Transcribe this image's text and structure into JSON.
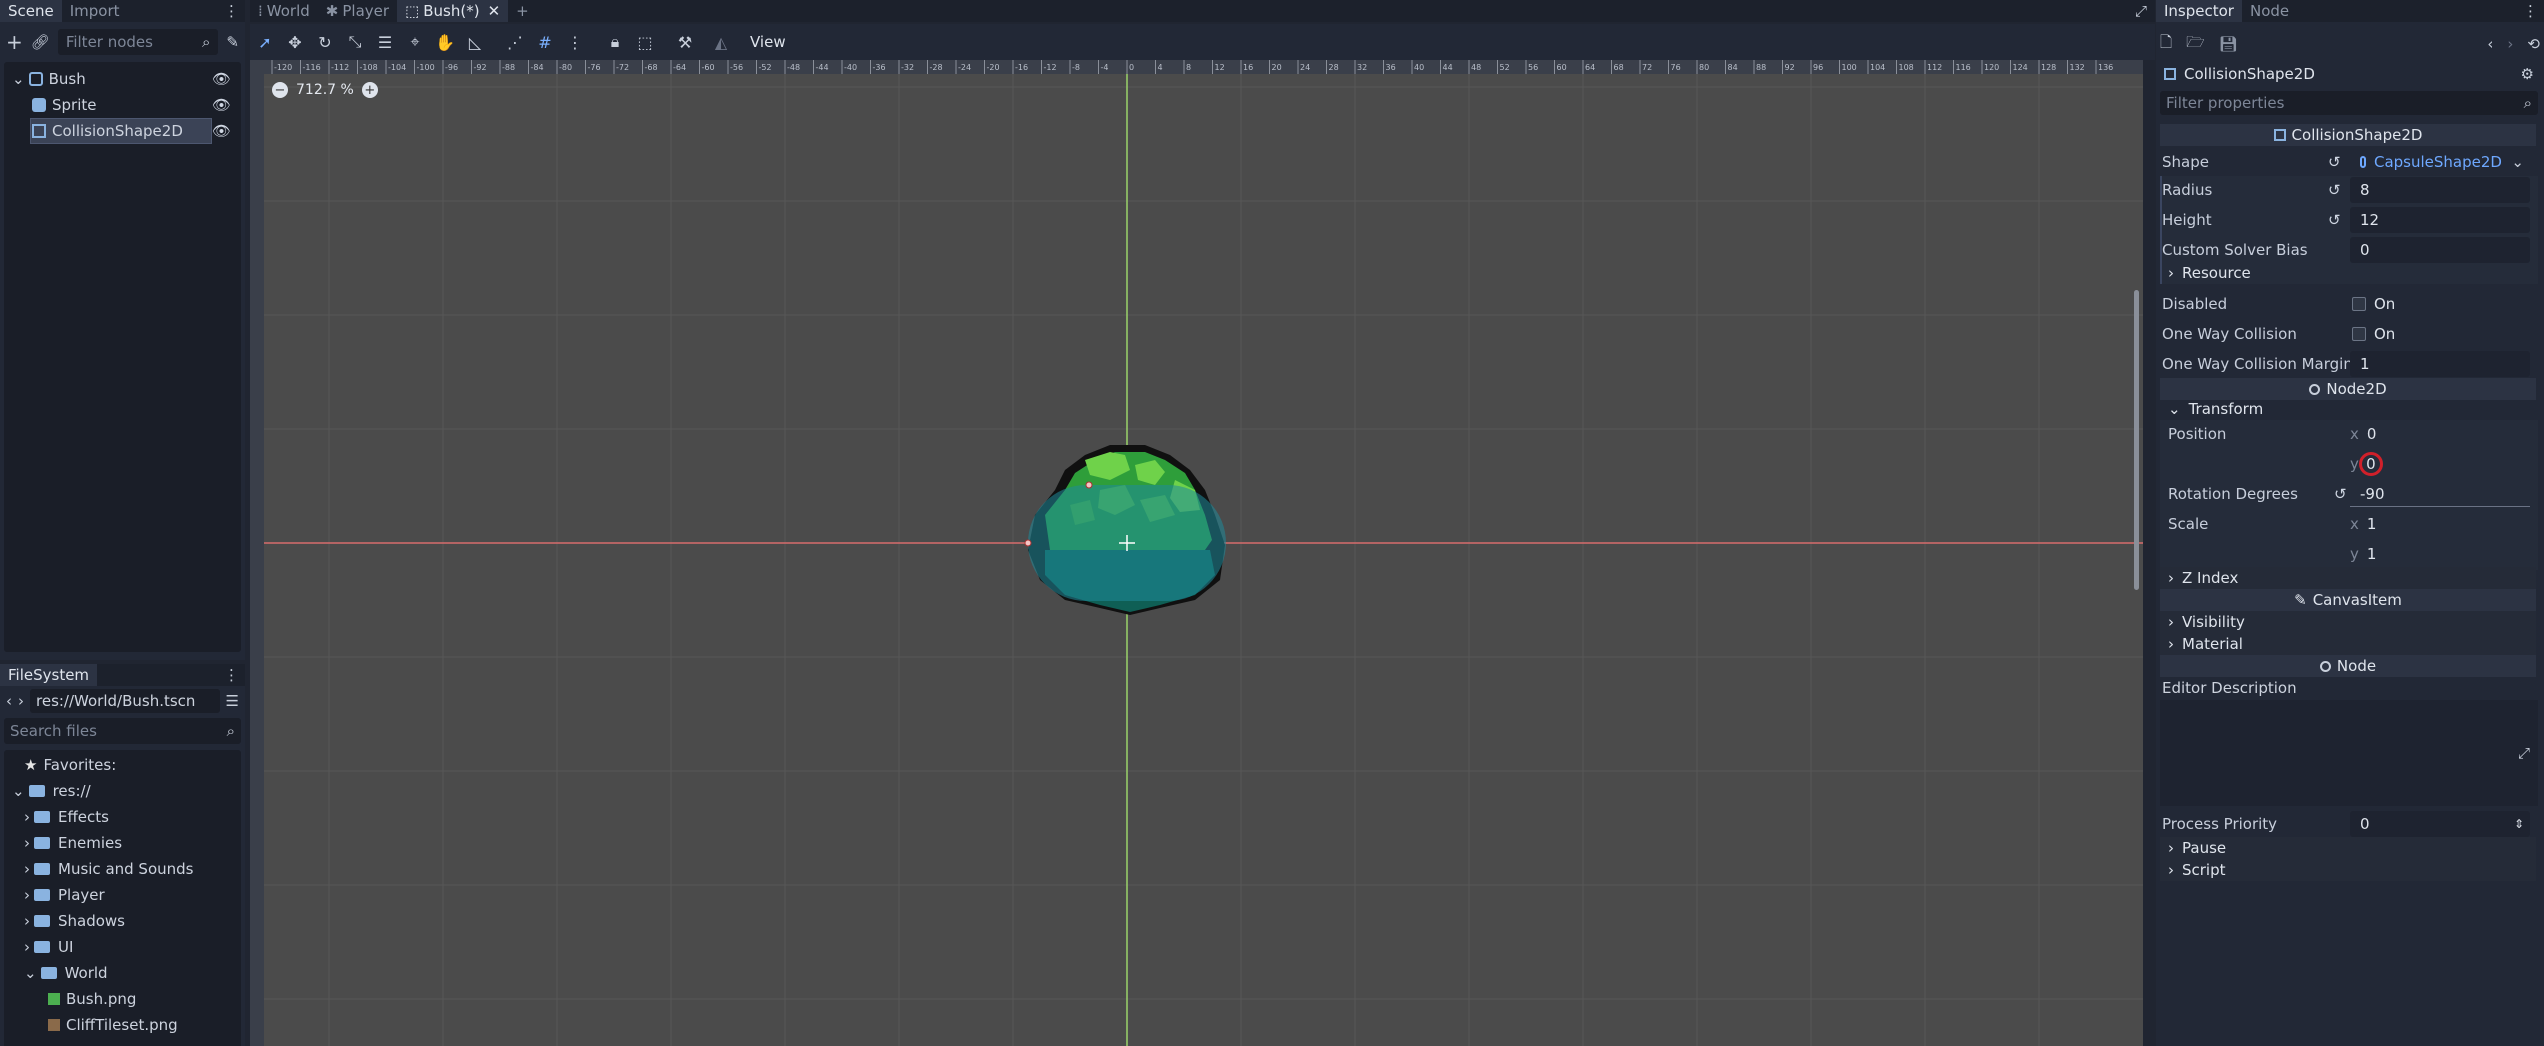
{
  "scene_dock": {
    "tabs": [
      "Scene",
      "Import"
    ],
    "filter_placeholder": "Filter nodes",
    "tree": [
      {
        "label": "Bush",
        "icon": "node2d-icon"
      },
      {
        "label": "Sprite",
        "icon": "sprite-icon"
      },
      {
        "label": "CollisionShape2D",
        "icon": "collisionshape-icon"
      }
    ]
  },
  "filesystem": {
    "title": "FileSystem",
    "path": "res://World/Bush.tscn",
    "search_placeholder": "Search files",
    "items": [
      {
        "label": "Favorites:",
        "kind": "favorites"
      },
      {
        "label": "res://",
        "kind": "root"
      },
      {
        "label": "Effects",
        "kind": "folder"
      },
      {
        "label": "Enemies",
        "kind": "folder"
      },
      {
        "label": "Music and Sounds",
        "kind": "folder"
      },
      {
        "label": "Player",
        "kind": "folder"
      },
      {
        "label": "Shadows",
        "kind": "folder"
      },
      {
        "label": "UI",
        "kind": "folder"
      },
      {
        "label": "World",
        "kind": "folder-open"
      },
      {
        "label": "Bush.png",
        "kind": "image"
      },
      {
        "label": "CliffTileset.png",
        "kind": "image"
      }
    ]
  },
  "editor_tabs": [
    {
      "label": "World",
      "active": false
    },
    {
      "label": "Player",
      "active": false
    },
    {
      "label": "Bush(*)",
      "active": true
    }
  ],
  "viewport": {
    "view_menu": "View",
    "zoom": "712.7 %",
    "ruler_labels": [
      "-120",
      "-116",
      "-112",
      "-108",
      "-104",
      "-100",
      "-96",
      "-92",
      "-88",
      "-84",
      "-80",
      "-76",
      "-72",
      "-68",
      "-64",
      "-60",
      "-56",
      "-52",
      "-48",
      "-44",
      "-40",
      "-36",
      "-32",
      "-28",
      "-24",
      "-20",
      "-16",
      "-12",
      "-8",
      "-4",
      "0",
      "4",
      "8",
      "12",
      "16",
      "20",
      "24",
      "28",
      "32",
      "36",
      "40",
      "44",
      "48",
      "52",
      "56",
      "60",
      "64",
      "68",
      "72",
      "76",
      "80",
      "84",
      "88",
      "92",
      "96",
      "100",
      "104",
      "108",
      "112",
      "116",
      "120",
      "124",
      "128",
      "132",
      "136"
    ],
    "colors": {
      "bg": "#4b4b4b",
      "grid": "#575757",
      "x_axis": "#d86c6c",
      "y_axis": "#9ad36a",
      "capsule": "#1f8a9a"
    }
  },
  "inspector": {
    "tabs": [
      "Inspector",
      "Node"
    ],
    "object_name": "CollisionShape2D",
    "filter_placeholder": "Filter properties",
    "sections": {
      "collision": "CollisionShape2D",
      "node2d": "Node2D",
      "canvasitem": "CanvasItem",
      "node": "Node"
    },
    "shape_label": "Shape",
    "shape_value": "CapsuleShape2D",
    "radius_label": "Radius",
    "radius_value": "8",
    "height_label": "Height",
    "height_value": "12",
    "bias_label": "Custom Solver Bias",
    "bias_value": "0",
    "resource_label": "Resource",
    "disabled_label": "Disabled",
    "disabled_value": "On",
    "oneway_label": "One Way Collision",
    "oneway_value": "On",
    "margin_label": "One Way Collision Margin",
    "margin_value": "1",
    "transform_label": "Transform",
    "position_label": "Position",
    "pos_x": "0",
    "pos_y": "0",
    "rotation_label": "Rotation Degrees",
    "rotation_value": "-90",
    "scale_label": "Scale",
    "scale_x": "1",
    "scale_y": "1",
    "zindex_label": "Z Index",
    "visibility_label": "Visibility",
    "material_label": "Material",
    "editor_desc_label": "Editor Description",
    "priority_label": "Process Priority",
    "priority_value": "0",
    "pause_label": "Pause",
    "script_label": "Script",
    "axis_x": "x",
    "axis_y": "y"
  }
}
